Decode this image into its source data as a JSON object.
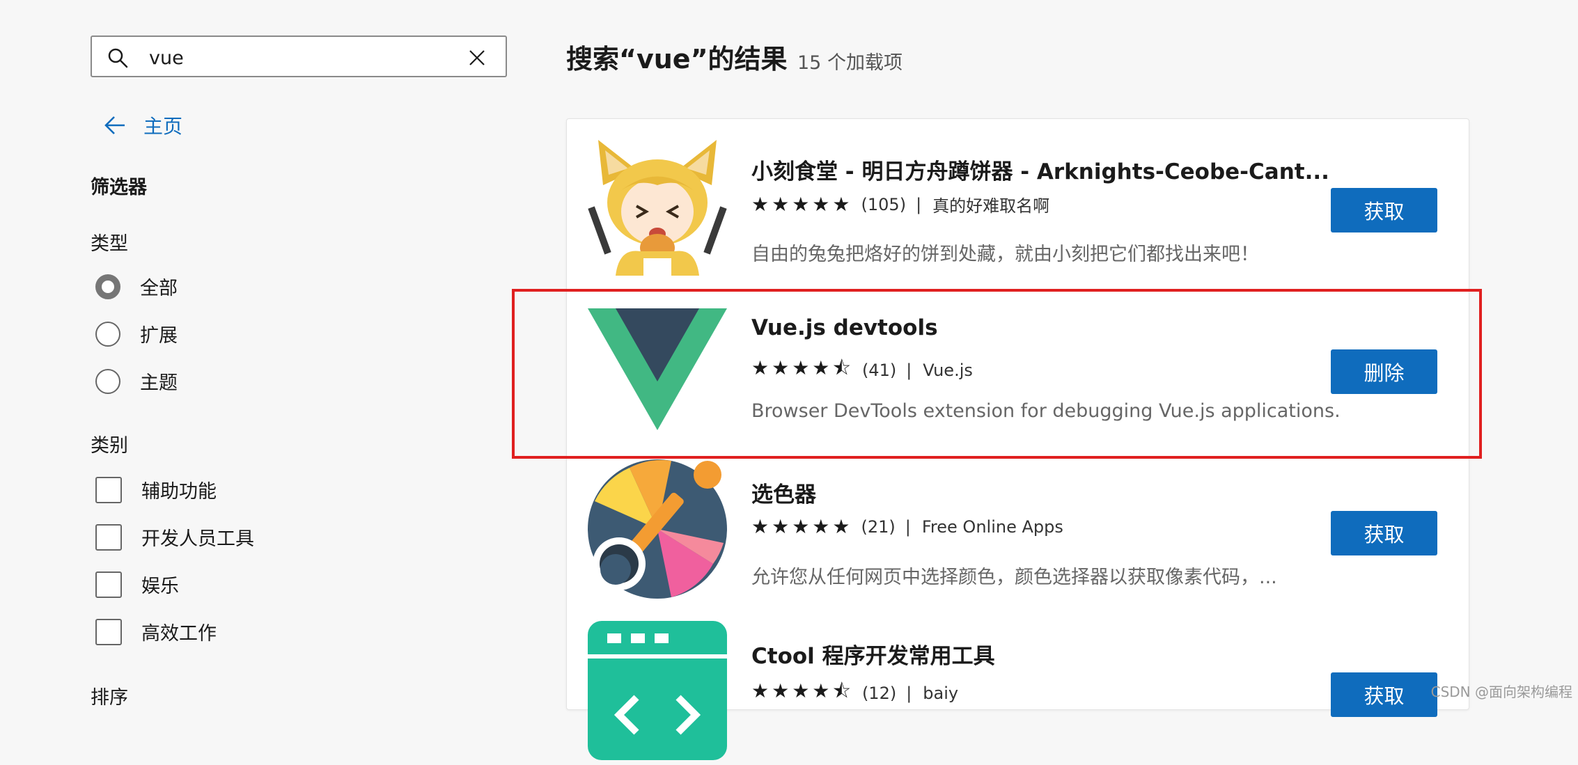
{
  "search": {
    "value": "vue",
    "placeholder": ""
  },
  "nav": {
    "home_label": "主页"
  },
  "filters": {
    "title": "筛选器",
    "type": {
      "title": "类型",
      "options": [
        "全部",
        "扩展",
        "主题"
      ],
      "selected": "全部"
    },
    "category": {
      "title": "类别",
      "options": [
        "辅助功能",
        "开发人员工具",
        "娱乐",
        "高效工作"
      ]
    },
    "sort_title": "排序"
  },
  "results": {
    "title": "搜索“vue”的结果",
    "count": "15 个加载项",
    "items": [
      {
        "name": "小刻食堂 - 明日方舟蹲饼器 - Arknights-Ceobe-Cant...",
        "stars": "★★★★★",
        "rating": 5,
        "rating_count": "(105)",
        "publisher": "真的好难取名啊",
        "description": "自由的兔兔把烙好的饼到处藏，就由小刻把它们都找出来吧！",
        "button": "获取",
        "icon": "ceobe-character-icon"
      },
      {
        "name": "Vue.js devtools",
        "stars": "★★★★⯪",
        "rating": 4.5,
        "rating_count": "(41)",
        "publisher": "Vue.js",
        "description": "Browser DevTools extension for debugging Vue.js applications.",
        "button": "删除",
        "icon": "vue-logo-icon"
      },
      {
        "name": "选色器",
        "stars": "★★★★★",
        "rating": 5,
        "rating_count": "(21)",
        "publisher": "Free Online Apps",
        "description": "允许您从任何网页中选择颜色，颜色选择器以获取像素代码，...",
        "button": "获取",
        "icon": "color-picker-icon"
      },
      {
        "name": "Ctool 程序开发常用工具",
        "stars": "★★★★⯪",
        "rating": 4.5,
        "rating_count": "(12)",
        "publisher": "baiy",
        "description": "",
        "button": "获取",
        "icon": "ctool-icon"
      }
    ]
  },
  "watermark": "CSDN @面向架构编程",
  "colors": {
    "accent": "#0f6cbd",
    "highlight": "#e02020",
    "vue_green": "#41b883",
    "vue_dark": "#34495e"
  }
}
